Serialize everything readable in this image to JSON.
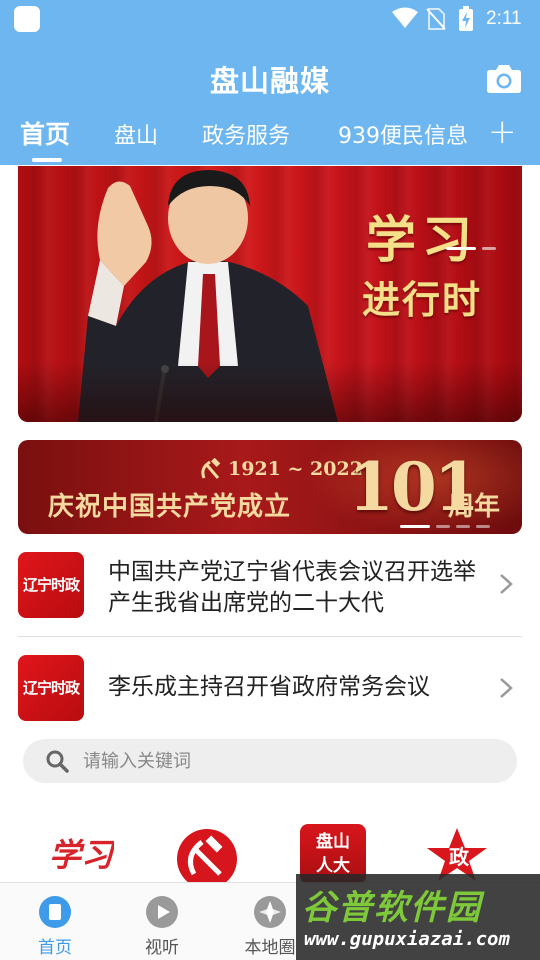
{
  "status_bar": {
    "time": "2:11",
    "icons": [
      "wifi-icon",
      "no-sim-icon",
      "battery-charging-icon"
    ]
  },
  "header": {
    "title": "盘山融媒",
    "camera_icon": "camera-icon"
  },
  "tabs": [
    {
      "label": "首页",
      "active": true
    },
    {
      "label": "盘山",
      "active": false
    },
    {
      "label": "政务服务",
      "active": false
    },
    {
      "label": "939便民信息",
      "active": false
    }
  ],
  "tab_add_label": "+",
  "banner_main": {
    "line1": "学习",
    "line2": "进行时",
    "slides": 2,
    "active_slide": 1
  },
  "banner_anniversary": {
    "years": "1921 ~ 2022",
    "slogan": "庆祝中国共产党成立",
    "number": "101",
    "suffix": "周年",
    "slides": 4,
    "active_slide": 1
  },
  "news": [
    {
      "thumb_label": "辽宁时政",
      "title": "中国共产党辽宁省代表会议召开选举产生我省出席党的二十大代"
    },
    {
      "thumb_label": "辽宁时政",
      "title": "李乐成主持召开省政府常务会议"
    }
  ],
  "search": {
    "placeholder": "请输入关键词"
  },
  "shortcuts": [
    {
      "label": "学习",
      "icon": "xuexi-logo-icon"
    },
    {
      "label": "",
      "icon": "party-emblem-icon"
    },
    {
      "label": "盘山人大",
      "icon": "panshan-renda-icon"
    },
    {
      "label": "政",
      "icon": "red-star-icon"
    }
  ],
  "bottom_nav": [
    {
      "label": "首页",
      "icon": "home-icon",
      "active": true
    },
    {
      "label": "视听",
      "icon": "play-icon",
      "active": false
    },
    {
      "label": "本地圈",
      "icon": "compass-icon",
      "active": false
    }
  ],
  "watermark": {
    "brand": "谷普软件园",
    "url": "www.gupuxiazai.com"
  },
  "colors": {
    "header": "#6db6ef",
    "active_nav": "#3d9be9",
    "news_thumb": "#e0161b",
    "banner_red": "#c4121a",
    "gold_text": "#f5e08a"
  }
}
